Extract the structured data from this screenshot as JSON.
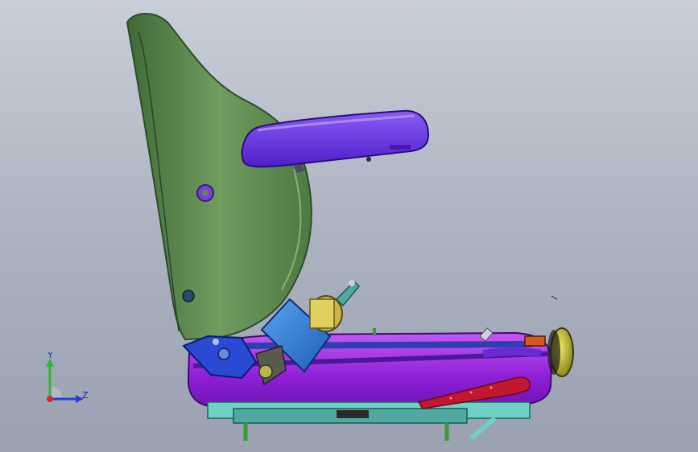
{
  "scene": {
    "model": "seat-assembly",
    "background_top": "#c9ced8",
    "background_bottom": "#9aa1b0",
    "colors": {
      "backrest": "#5c8a4f",
      "backrest_edge": "#2f4b2a",
      "armrest": "#6a33e0",
      "base_frame": "#a22fe0",
      "recliner_block": "#2e7bd6",
      "retractor": "#c8b64a",
      "bracket_teal": "#4fa9a0",
      "slide_rail": "#6fd1c4",
      "red_lever": "#c0192f",
      "knob": "#c9c52a"
    }
  },
  "triad": {
    "y_label": "Y",
    "z_label": "Z",
    "y_color": "#2fb52f",
    "z_color": "#2a3fd6",
    "origin_color": "#d62a2a"
  }
}
